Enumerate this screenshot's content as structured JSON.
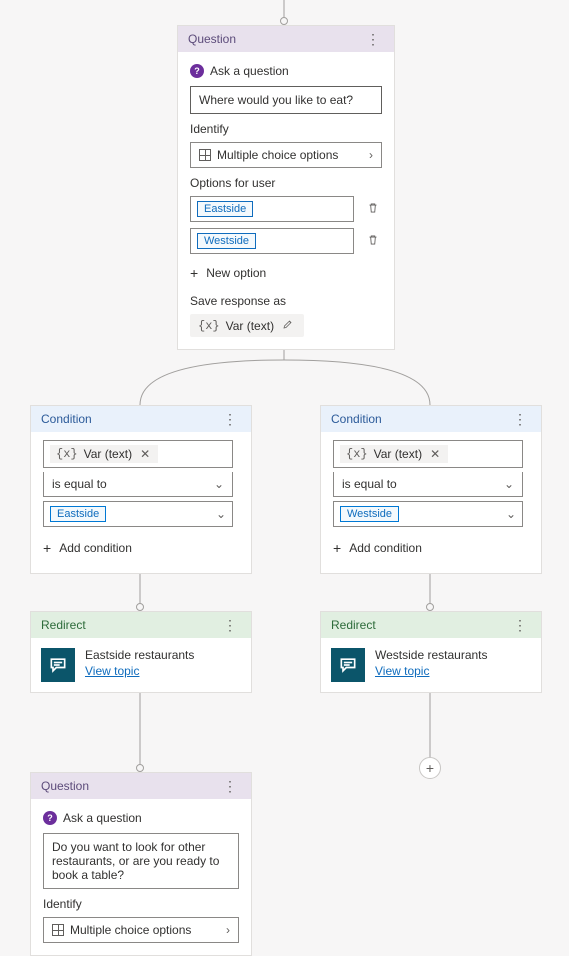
{
  "question1": {
    "header": "Question",
    "ask_label": "Ask a question",
    "prompt": "Where would you like to eat?",
    "identify_label": "Identify",
    "identify_value": "Multiple choice options",
    "options_label": "Options for user",
    "option_a": "Eastside",
    "option_b": "Westside",
    "new_option_label": "New option",
    "save_label": "Save response as",
    "var_name": "Var (text)"
  },
  "condition_left": {
    "header": "Condition",
    "var_name": "Var (text)",
    "operator": "is equal to",
    "value": "Eastside",
    "add_label": "Add condition"
  },
  "condition_right": {
    "header": "Condition",
    "var_name": "Var (text)",
    "operator": "is equal to",
    "value": "Westside",
    "add_label": "Add condition"
  },
  "redirect_left": {
    "header": "Redirect",
    "title": "Eastside restaurants",
    "link": "View topic"
  },
  "redirect_right": {
    "header": "Redirect",
    "title": "Westside restaurants",
    "link": "View topic"
  },
  "question2": {
    "header": "Question",
    "ask_label": "Ask a question",
    "prompt": "Do you want to look for other restaurants, or are you ready to book a table?",
    "identify_label": "Identify",
    "identify_value": "Multiple choice options"
  },
  "var_brace": "{x}"
}
